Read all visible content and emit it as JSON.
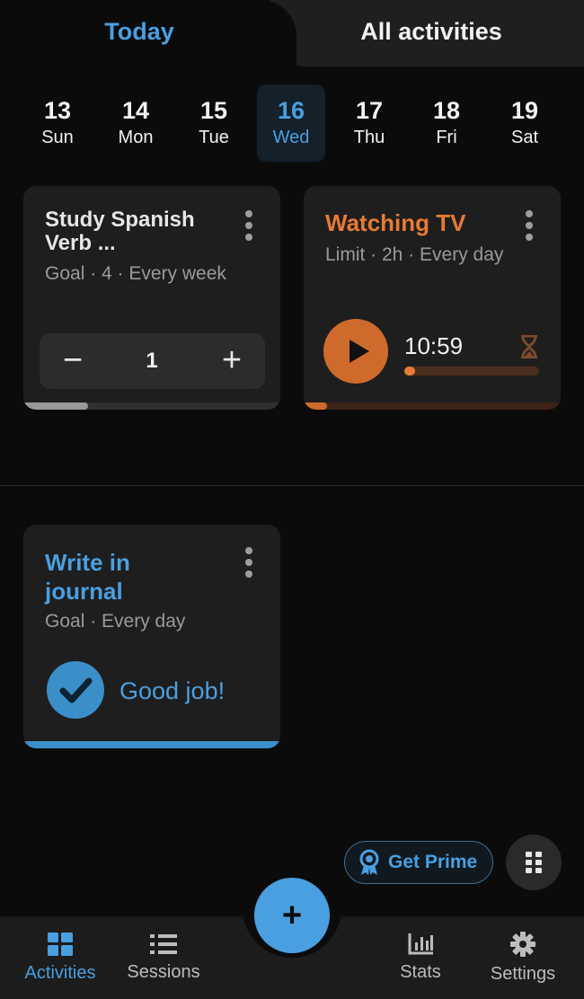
{
  "tabs": {
    "today": "Today",
    "all": "All activities"
  },
  "dates": [
    {
      "num": "13",
      "dow": "Sun"
    },
    {
      "num": "14",
      "dow": "Mon"
    },
    {
      "num": "15",
      "dow": "Tue"
    },
    {
      "num": "16",
      "dow": "Wed",
      "selected": true
    },
    {
      "num": "17",
      "dow": "Thu"
    },
    {
      "num": "18",
      "dow": "Fri"
    },
    {
      "num": "19",
      "dow": "Sat"
    }
  ],
  "cards": {
    "spanish": {
      "title": "Study Spanish Verb ...",
      "subtitle": "Goal · 4 · Every week",
      "minus": "−",
      "count": "1",
      "plus": "+",
      "progress_fraction": 0.25
    },
    "tv": {
      "title": "Watching TV",
      "subtitle": "Limit · 2h · Every day",
      "timer": "10:59",
      "progress_fraction": 0.09,
      "bar_fraction": 0.08
    },
    "journal": {
      "title": "Write in journal",
      "subtitle": "Goal · Every day",
      "status": "Good job!",
      "progress_fraction": 1.0
    }
  },
  "prime": {
    "label": "Get Prime"
  },
  "fab": {
    "label": "+"
  },
  "nav": {
    "activities": "Activities",
    "sessions": "Sessions",
    "stats": "Stats",
    "settings": "Settings"
  },
  "colors": {
    "accent": "#4a9fe0",
    "tv": "#e87a34",
    "background": "#0b0b0b",
    "card": "#1e1e1e"
  }
}
